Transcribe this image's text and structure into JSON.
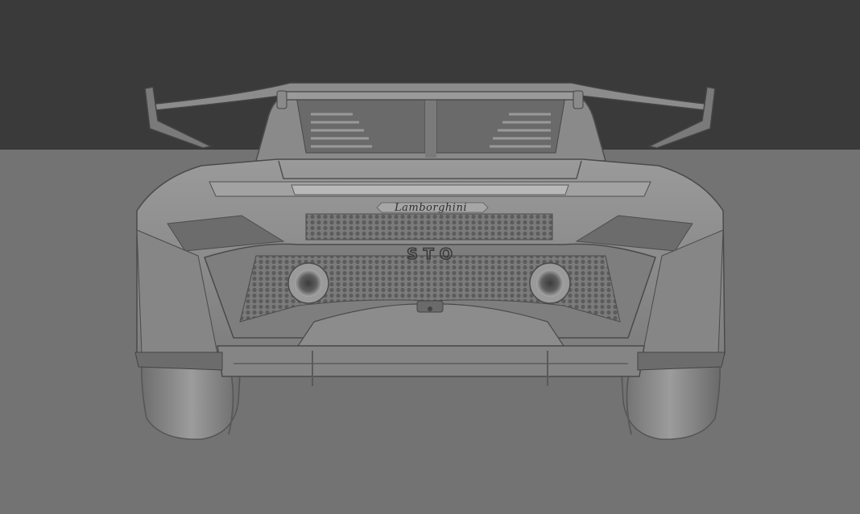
{
  "viewport": {
    "background_top": "#3a3a3a",
    "ground_color": "#737373",
    "body_color": "#8e8e8e",
    "shadow_color": "#5a5a5a",
    "highlight_color": "#b4b4b4"
  },
  "car": {
    "brand_badge": "Lamborghini",
    "model_badge": "STO"
  }
}
